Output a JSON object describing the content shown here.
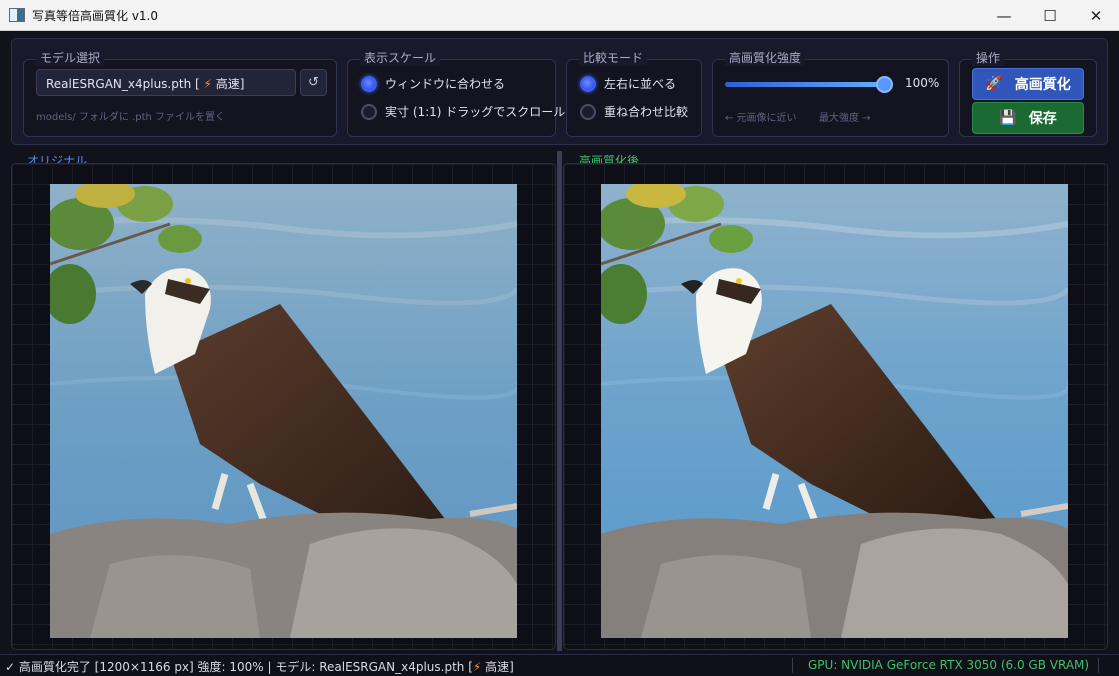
{
  "window": {
    "title": "写真等倍高画質化  v1.0",
    "minimize": "—",
    "maximize": "☐",
    "close": "✕"
  },
  "model": {
    "group_title": "モデル選択",
    "selected_name": "RealESRGAN_x4plus.pth",
    "selected_mode_open": "[",
    "selected_mode_icon": "⚡",
    "selected_mode_label": "高速]",
    "reload_glyph": "↺",
    "hint": "models/ フォルダに .pth ファイルを置く"
  },
  "scale": {
    "group_title": "表示スケール",
    "options": [
      {
        "label": "ウィンドウに合わせる",
        "selected": true
      },
      {
        "label": "実寸 (1:1)  ドラッグでスクロール",
        "selected": false
      }
    ]
  },
  "compare": {
    "group_title": "比較モード",
    "options": [
      {
        "label": "左右に並べる",
        "selected": true
      },
      {
        "label": "重ね合わせ比較",
        "selected": false
      }
    ]
  },
  "strength": {
    "group_title": "高画質化強度",
    "value": 1.0,
    "value_label": "100%",
    "left_caption": "← 元画像に近い",
    "right_caption": "最大強度 →"
  },
  "operations": {
    "group_title": "操作",
    "enhance_label": "高画質化",
    "enhance_icon": "🚀",
    "save_label": "保存",
    "save_icon": "💾"
  },
  "panels": {
    "original_label": "オリジナル",
    "enhanced_label": "高画質化後"
  },
  "status": {
    "prefix": "✓ 高画質化完了  [1200×1166 px]  強度: 100%  |  モデル: RealESRGAN_x4plus.pth  [",
    "bolt": "⚡",
    "suffix": " 高速]",
    "gpu": "GPU: NVIDIA GeForce RTX 3050  (6.0 GB VRAM)"
  },
  "colors": {
    "accent_blue": "#3d5ef0",
    "success_green": "#3fc06a",
    "background": "#11121c"
  }
}
